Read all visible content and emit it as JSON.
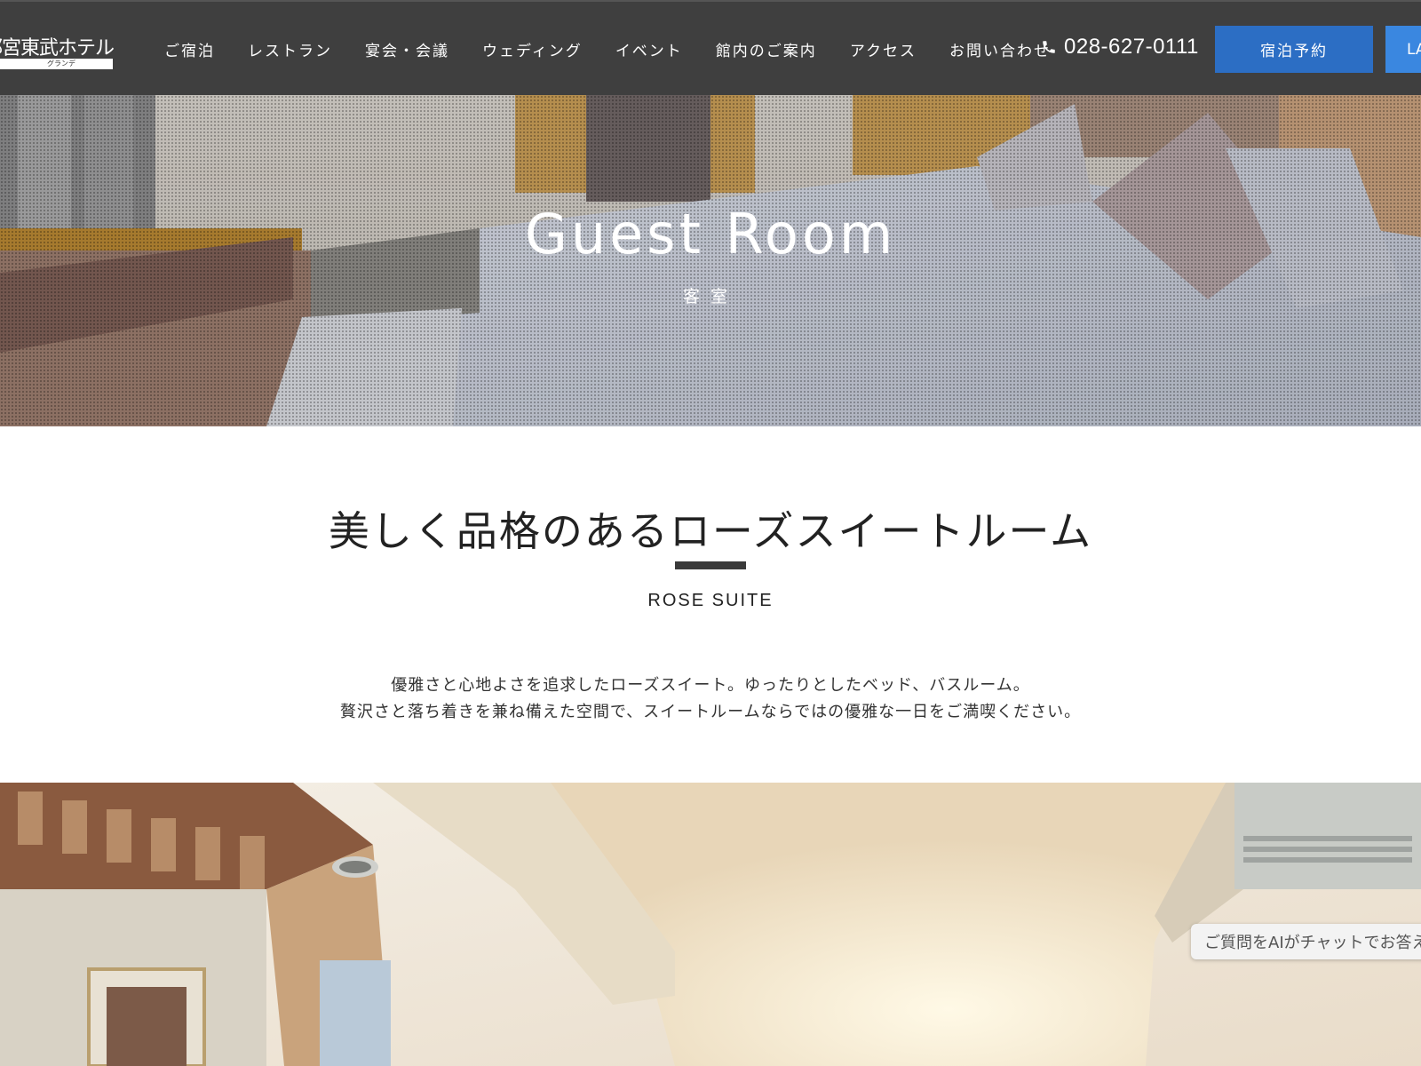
{
  "header": {
    "logo_text": "宇都宮東武ホテル",
    "logo_sub": "グランデ",
    "nav": [
      {
        "label": "ご宿泊"
      },
      {
        "label": "レストラン"
      },
      {
        "label": "宴会・会議"
      },
      {
        "label": "ウェディング"
      },
      {
        "label": "イベント"
      },
      {
        "label": "館内のご案内"
      },
      {
        "label": "アクセス"
      },
      {
        "label": "お問い合わせ"
      }
    ],
    "phone": "028-627-0111",
    "reserve_label": "宿泊予約",
    "lang_label": "LA"
  },
  "hero": {
    "title": "Guest Room",
    "subtitle": "客室"
  },
  "section": {
    "heading": "美しく品格のあるローズスイートルーム",
    "heading_en": "ROSE SUITE",
    "desc_line1": "優雅さと心地よさを追求したローズスイート。ゆったりとしたベッド、バスルーム。",
    "desc_line2": "贅沢さと落ち着きを兼ね備えた空間で、スイートルームならではの優雅な一日をご満喫ください。"
  },
  "chat": {
    "label": "ご質問をAIがチャットでお答えします"
  },
  "colors": {
    "header_bg": "#3f3f3f",
    "reserve_button": "#2c6ec4",
    "lang_button": "#3a87e0"
  }
}
